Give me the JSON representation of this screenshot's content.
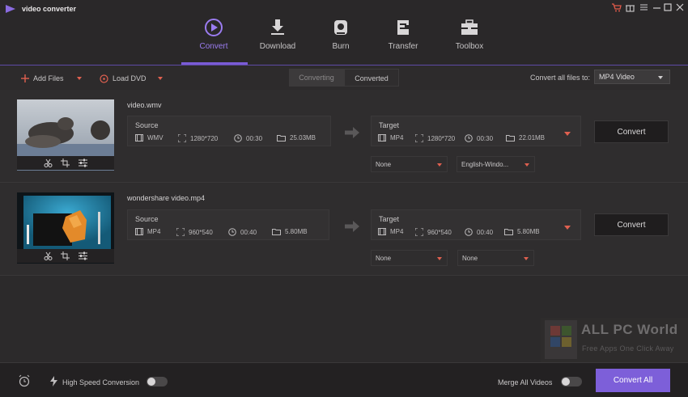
{
  "app": {
    "title": "video converter"
  },
  "window_controls": [
    "cart-icon",
    "gift-icon",
    "menu-icon",
    "minimize-icon",
    "maximize-icon",
    "close-icon"
  ],
  "nav": {
    "items": [
      {
        "label": "Convert",
        "icon": "play-circle-icon",
        "active": true
      },
      {
        "label": "Download",
        "icon": "download-icon",
        "active": false
      },
      {
        "label": "Burn",
        "icon": "disc-icon",
        "active": false
      },
      {
        "label": "Transfer",
        "icon": "transfer-icon",
        "active": false
      },
      {
        "label": "Toolbox",
        "icon": "toolbox-icon",
        "active": false
      }
    ]
  },
  "toolbar": {
    "add_files": "Add Files",
    "load_dvd": "Load DVD",
    "tab_converting": "Converting",
    "tab_converted": "Converted",
    "convert_all_label": "Convert all files to:",
    "convert_all_format": "MP4 Video"
  },
  "files": [
    {
      "name": "video.wmv",
      "source": {
        "title": "Source",
        "format": "WMV",
        "resolution": "1280*720",
        "duration": "00:30",
        "size": "25.03MB"
      },
      "target": {
        "title": "Target",
        "format": "MP4",
        "resolution": "1280*720",
        "duration": "00:30",
        "size": "22.01MB"
      },
      "subtitle": "None",
      "audio": "English-Windo...",
      "convert_label": "Convert"
    },
    {
      "name": "wondershare video.mp4",
      "source": {
        "title": "Source",
        "format": "MP4",
        "resolution": "960*540",
        "duration": "00:40",
        "size": "5.80MB"
      },
      "target": {
        "title": "Target",
        "format": "MP4",
        "resolution": "960*540",
        "duration": "00:40",
        "size": "5.80MB"
      },
      "subtitle": "None",
      "audio": "None",
      "convert_label": "Convert"
    }
  ],
  "bottom": {
    "high_speed_label": "High Speed Conversion",
    "high_speed_on": false,
    "merge_label": "Merge All Videos",
    "merge_on": false,
    "convert_all": "Convert All"
  },
  "watermark": {
    "title": "ALL PC World",
    "subtitle": "Free Apps One Click Away"
  },
  "colors": {
    "accent": "#7d5fd9",
    "dropdown_arrow": "#e06050",
    "background": "#2c2a2b"
  }
}
